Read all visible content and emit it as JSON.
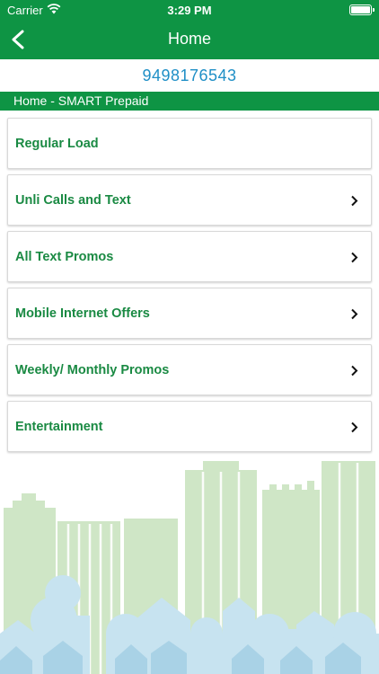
{
  "status": {
    "carrier": "Carrier",
    "time": "3:29 PM"
  },
  "nav": {
    "title": "Home"
  },
  "account": {
    "number": "9498176543"
  },
  "breadcrumb": "Home - SMART Prepaid",
  "menu": [
    {
      "label": "Regular Load",
      "has_chevron": false
    },
    {
      "label": "Unli Calls and Text",
      "has_chevron": true
    },
    {
      "label": "All Text Promos",
      "has_chevron": true
    },
    {
      "label": "Mobile Internet Offers",
      "has_chevron": true
    },
    {
      "label": "Weekly/ Monthly Promos",
      "has_chevron": true
    },
    {
      "label": "Entertainment",
      "has_chevron": true
    }
  ],
  "icons": {
    "back": "chevron-left-icon",
    "menu_chevron": "chevron-right-icon",
    "wifi": "wifi-icon",
    "battery": "battery-icon",
    "background": "city-skyline-illustration"
  },
  "colors": {
    "brand_green": "#0e9444",
    "label_green": "#1a8a43",
    "number_blue": "#1f8fc6",
    "building_green": "#cfe6c6",
    "house_blue": "#c7e3f0"
  }
}
